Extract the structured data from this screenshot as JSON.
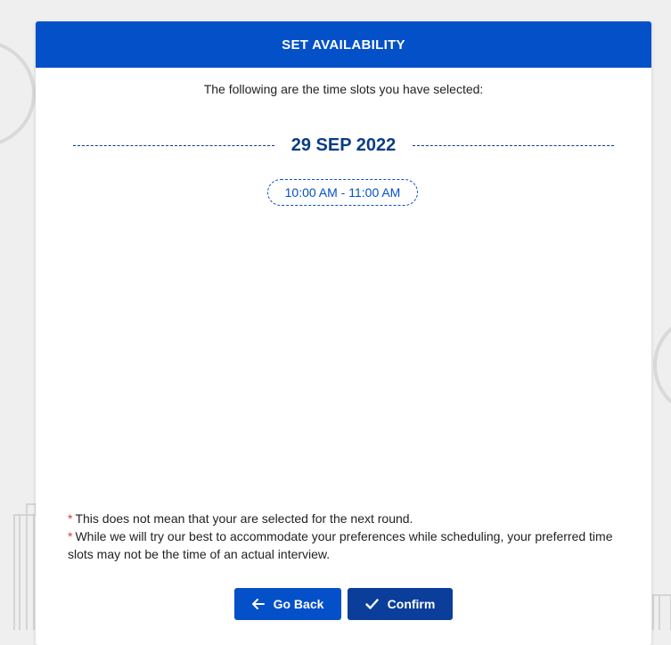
{
  "modal": {
    "title": "SET AVAILABILITY",
    "intro": "The following are the time slots you have selected:",
    "date": "29 SEP 2022",
    "slots": [
      "10:00 AM - 11:00 AM"
    ],
    "notes": [
      "This does not mean that your are selected for the next round.",
      "While we will try our best to accommodate your preferences while scheduling, your preferred time slots may not be the time of an actual interview."
    ],
    "note_marker": "*",
    "buttons": {
      "back_label": "Go Back",
      "confirm_label": "Confirm"
    }
  },
  "icons": {
    "back": "arrow-left-icon",
    "confirm": "check-icon"
  },
  "colors": {
    "header": "#0450c8",
    "date_text": "#0b3c86",
    "back_button": "#0450c8",
    "confirm_button": "#0b3e9a",
    "asterisk": "#e03a2a"
  }
}
